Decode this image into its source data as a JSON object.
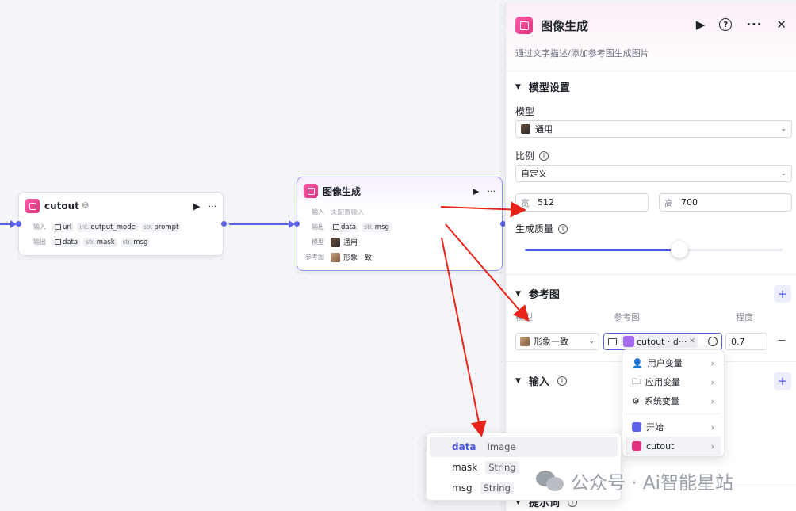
{
  "canvas": {
    "node_cutout": {
      "title": "cutout",
      "input_label": "输入",
      "output_label": "输出",
      "inputs": [
        {
          "type": "",
          "name": "url",
          "icon": "image"
        },
        {
          "type": "int.",
          "name": "output_mode"
        },
        {
          "type": "str.",
          "name": "prompt"
        }
      ],
      "outputs": [
        {
          "type": "",
          "name": "data",
          "icon": "image"
        },
        {
          "type": "str.",
          "name": "mask"
        },
        {
          "type": "str.",
          "name": "msg"
        }
      ]
    },
    "node_imagegen": {
      "title": "图像生成",
      "input_label": "输入",
      "input_value": "未配置输入",
      "output_label": "输出",
      "outputs": [
        {
          "type": "",
          "name": "data",
          "icon": "image"
        },
        {
          "type": "str.",
          "name": "msg"
        }
      ],
      "model_label": "模型",
      "model_value": "通用",
      "ref_label": "参考图",
      "ref_value": "形象一致"
    }
  },
  "panel": {
    "title": "图像生成",
    "description": "通过文字描述/添加参考图生成图片",
    "model_section": "模型设置",
    "model_label": "模型",
    "model_value": "通用",
    "ratio_label": "比例",
    "ratio_value": "自定义",
    "width_prefix": "宽",
    "width_value": "512",
    "height_prefix": "高",
    "height_value": "700",
    "quality_label": "生成质量",
    "quality_fraction": 0.6,
    "ref_section": "参考图",
    "ref_col_model": "模型",
    "ref_col_image": "参考图",
    "ref_col_degree": "程度",
    "ref_model_value": "形象一致",
    "ref_var_value": "cutout · d···",
    "ref_degree_value": "0.7",
    "input_section": "输入",
    "prompt_section": "提示词"
  },
  "var_menu": {
    "items": [
      {
        "label": "用户变量",
        "icon": "user-icon"
      },
      {
        "label": "应用变量",
        "icon": "folder-icon"
      },
      {
        "label": "系统变量",
        "icon": "gear-icon"
      }
    ],
    "nodes": [
      {
        "label": "开始",
        "icon": "start-node-icon"
      },
      {
        "label": "cutout",
        "icon": "cutout-node-icon"
      }
    ]
  },
  "output_vars": [
    {
      "name": "data",
      "type": "Image"
    },
    {
      "name": "mask",
      "type": "String"
    },
    {
      "name": "msg",
      "type": "String"
    }
  ],
  "watermark": "公众号 · Ai智能星站",
  "colors": {
    "accent": "#4e55e0",
    "node_icon": "#e0307f",
    "arrow": "#e8231a"
  }
}
